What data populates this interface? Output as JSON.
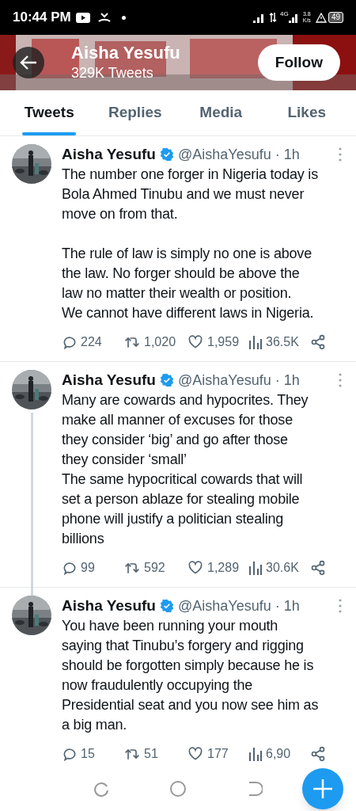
{
  "status_bar": {
    "time": "10:44 PM",
    "network": "4G",
    "speed": "3.8\nK/s",
    "battery": "49"
  },
  "header": {
    "name": "Aisha Yesufu",
    "subtitle": "329K Tweets",
    "follow_button": "Follow"
  },
  "tabs": [
    {
      "label": "Tweets",
      "selected": true
    },
    {
      "label": "Replies",
      "selected": false
    },
    {
      "label": "Media",
      "selected": false
    },
    {
      "label": "Likes",
      "selected": false
    }
  ],
  "tweets": [
    {
      "name": "Aisha Yesufu",
      "verified": true,
      "handle": "@AishaYesufu · 1h",
      "thread": false,
      "text": "The number one forger in Nigeria today is\nBola Ahmed Tinubu and we must never\nmove on from that.\n\nThe rule of law is simply no one is above\nthe law. No forger should be above the\nlaw no matter their wealth or position.\nWe cannot have different laws in Nigeria.",
      "replies": "224",
      "retweets": "1,020",
      "likes": "1,959",
      "views": "36.5K"
    },
    {
      "name": "Aisha Yesufu",
      "verified": true,
      "handle": "@AishaYesufu · 1h",
      "thread": true,
      "text": "Many are cowards and hypocrites. They\nmake all manner of excuses for those\nthey consider ‘big’ and go after those\nthey consider ‘small’\nThe same hypocritical cowards that will\nset a person ablaze for stealing mobile\nphone will justify a politician stealing\nbillions",
      "replies": "99",
      "retweets": "592",
      "likes": "1,289",
      "views": "30.6K"
    },
    {
      "name": "Aisha Yesufu",
      "verified": true,
      "handle": "@AishaYesufu · 1h",
      "thread": false,
      "text": "You have been running your mouth\nsaying that  Tinubu’s forgery and rigging\nshould be forgotten simply because he is\nnow fraudulently occupying the\nPresidential seat and you now see him as\na big man.",
      "replies": "15",
      "retweets": "51",
      "likes": "177",
      "views": "6,90"
    }
  ]
}
